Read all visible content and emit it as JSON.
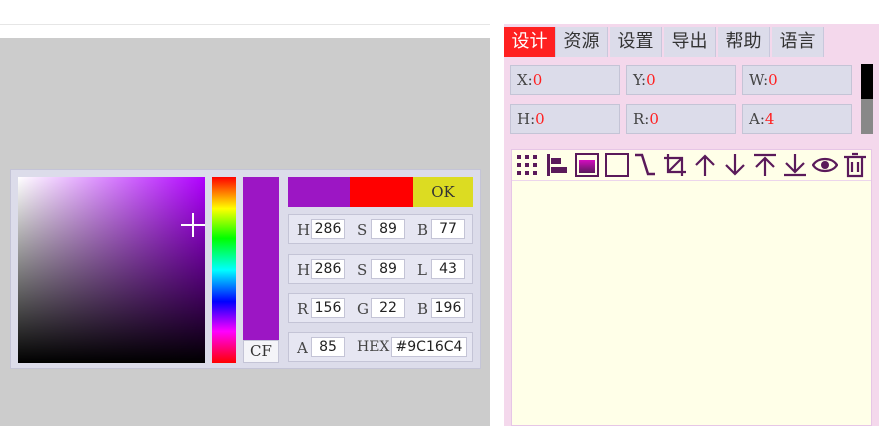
{
  "picker": {
    "cf_label": "CF",
    "ok_label": "OK",
    "hsv": {
      "h_label": "H",
      "h": "286",
      "s_label": "S",
      "s": "89",
      "b_label": "B",
      "b": "77"
    },
    "hsl": {
      "h_label": "H",
      "h": "286",
      "s_label": "S",
      "s": "89",
      "l_label": "L",
      "l": "43"
    },
    "rgb": {
      "r_label": "R",
      "r": "156",
      "g_label": "G",
      "g": "22",
      "b_label": "B",
      "b": "196"
    },
    "alpha": {
      "a_label": "A",
      "a": "85",
      "hex_label": "HEX",
      "hex": "#9C16C4"
    },
    "colors": {
      "new": "#9c16c4",
      "old": "#ff0000",
      "ok": "#dcdc22"
    }
  },
  "tabs": [
    {
      "label": "设计",
      "active": true
    },
    {
      "label": "资源"
    },
    {
      "label": "设置"
    },
    {
      "label": "导出"
    },
    {
      "label": "帮助"
    },
    {
      "label": "语言"
    }
  ],
  "props": {
    "x": {
      "label": "X:",
      "value": "0"
    },
    "y": {
      "label": "Y:",
      "value": "0"
    },
    "w": {
      "label": "W:",
      "value": "0"
    },
    "h": {
      "label": "H:",
      "value": "0"
    },
    "r": {
      "label": "R:",
      "value": "0"
    },
    "a": {
      "label": "A:",
      "value": "4"
    }
  },
  "tools": [
    "grid-icon",
    "align-left-icon",
    "fill-gradient-icon",
    "rectangle-icon",
    "connector-icon",
    "crop-icon",
    "arrow-up-icon",
    "arrow-down-icon",
    "bring-to-top-icon",
    "send-to-bottom-icon",
    "eye-icon",
    "delete-icon"
  ],
  "accent": "#ff2020"
}
